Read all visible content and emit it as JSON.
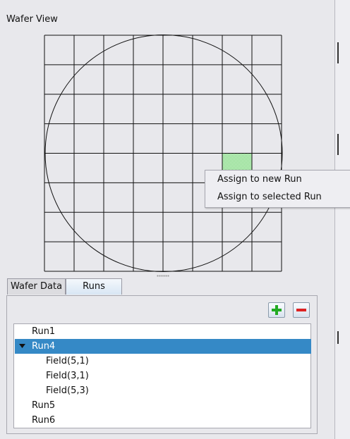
{
  "wafer_view": {
    "title": "Wafer View",
    "grid": {
      "columns": 8,
      "rows": 8
    },
    "selected_cells": [
      {
        "column": 6,
        "row": 4
      }
    ],
    "selected_cell_color": "#66dd66"
  },
  "context_menu": {
    "items": [
      {
        "label": "Assign to new Run"
      },
      {
        "label": "Assign to selected Run"
      }
    ]
  },
  "tabs": [
    {
      "label": "Wafer Data",
      "active": false
    },
    {
      "label": "Runs",
      "active": true
    }
  ],
  "runs_panel": {
    "add_icon": "plus-icon",
    "remove_icon": "minus-icon",
    "add_icon_color": "#22aa22",
    "remove_icon_color": "#dd2222",
    "tree": [
      {
        "label": "Run1",
        "level": 0,
        "expanded": false,
        "selected": false
      },
      {
        "label": "Run4",
        "level": 0,
        "expanded": true,
        "selected": true
      },
      {
        "label": "Field(5,1)",
        "level": 1,
        "selected": false
      },
      {
        "label": "Field(3,1)",
        "level": 1,
        "selected": false
      },
      {
        "label": "Field(5,3)",
        "level": 1,
        "selected": false
      },
      {
        "label": "Run5",
        "level": 0,
        "expanded": false,
        "selected": false
      },
      {
        "label": "Run6",
        "level": 0,
        "expanded": false,
        "selected": false
      }
    ],
    "selection_color": "#3589c6"
  }
}
